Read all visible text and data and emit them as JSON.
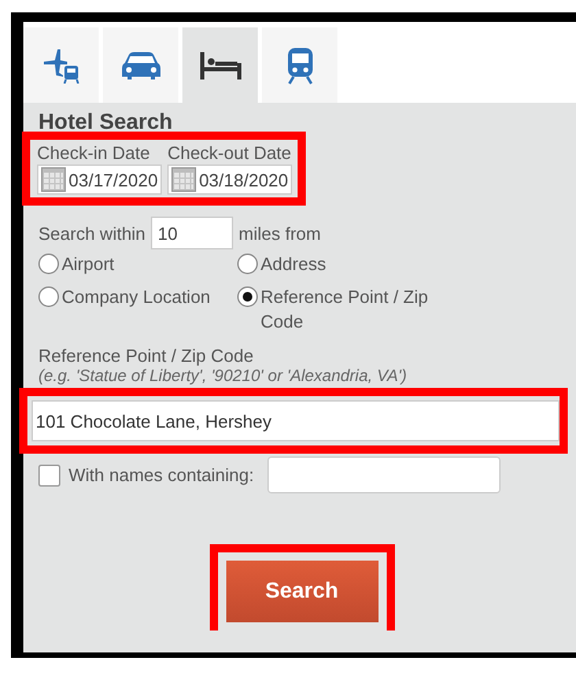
{
  "tabs": [
    {
      "kind": "flight-train",
      "selected": false
    },
    {
      "kind": "car",
      "selected": false
    },
    {
      "kind": "bed",
      "selected": true
    },
    {
      "kind": "train",
      "selected": false
    }
  ],
  "heading": "Hotel Search",
  "dates": {
    "highlighted": true,
    "fields": [
      {
        "label": "Check-in Date",
        "value": "03/17/2020"
      },
      {
        "label": "Check-out Date",
        "value": "03/18/2020"
      }
    ]
  },
  "radius": {
    "before": "Search within",
    "value": "10",
    "after": "miles from"
  },
  "search_from": [
    {
      "label": "Airport",
      "selected": false
    },
    {
      "label": "Address",
      "selected": false
    },
    {
      "label": "Company Location",
      "selected": false
    },
    {
      "label": "Reference Point / Zip Code",
      "selected": true
    }
  ],
  "reference": {
    "label": "Reference Point / Zip Code",
    "hint": "(e.g. 'Statue of Liberty', '90210' or 'Alexandria, VA')",
    "value": "101 Chocolate Lane, Hershey",
    "highlighted": true
  },
  "names_filter": {
    "label": "With names containing:",
    "checked": false
  },
  "search_button": {
    "label": "Search",
    "highlighted": true
  }
}
